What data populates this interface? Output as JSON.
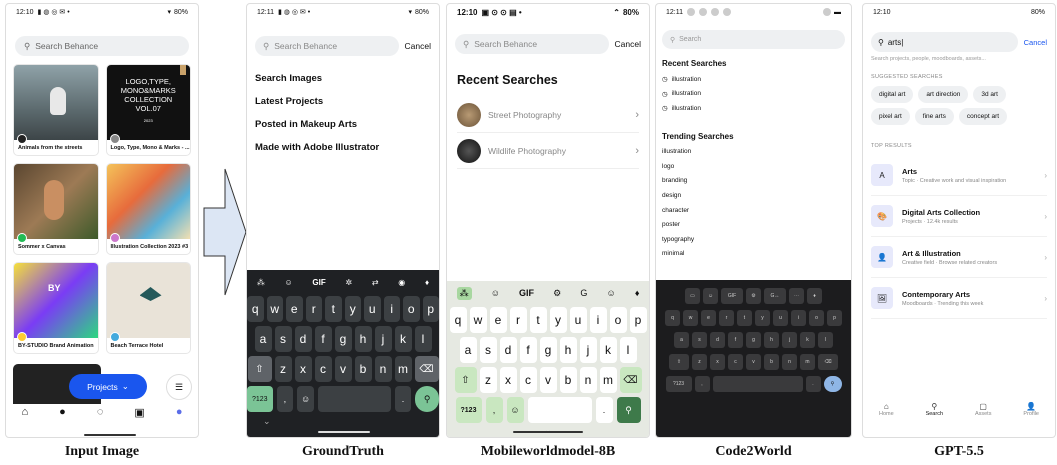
{
  "captions": [
    "Input Image",
    "GroundTruth",
    "Mobileworldmodel-8B",
    "Code2World",
    "GPT-5.5"
  ],
  "input": {
    "status": {
      "time": "12:10",
      "battery": "80%"
    },
    "search_placeholder": "Search Behance",
    "cards": [
      "Animals from the streets",
      "Logo, Type, Mono & Marks - ...",
      "Sommer x Canvas",
      "Illustration Collection 2023 #3",
      "BY-STUDIO Brand Animation",
      "Beach Terrace Hotel"
    ],
    "logo_card_text": [
      "LOGO,TYPE,",
      "MONO&MARKS",
      "COLLECTION",
      "VOL.07",
      "2023"
    ],
    "projects_button": "Projects"
  },
  "groundtruth": {
    "status": {
      "time": "12:11",
      "battery": "80%"
    },
    "search_placeholder": "Search Behance",
    "cancel": "Cancel",
    "suggestions": [
      "Search Images",
      "Latest Projects",
      "Posted in Makeup Arts",
      "Made with Adobe Illustrator"
    ],
    "kb_rows": [
      [
        "q",
        "w",
        "e",
        "r",
        "t",
        "y",
        "u",
        "i",
        "o",
        "p"
      ],
      [
        "a",
        "s",
        "d",
        "f",
        "g",
        "h",
        "j",
        "k",
        "l"
      ],
      [
        "z",
        "x",
        "c",
        "v",
        "b",
        "n",
        "m"
      ]
    ],
    "kb_gif": "GIF",
    "kb_num": "?123"
  },
  "mobile": {
    "status": {
      "time": "12:10",
      "battery": "80%"
    },
    "search_placeholder": "Search Behance",
    "cancel": "Cancel",
    "recent_title": "Recent Searches",
    "recent": [
      "Street Photography",
      "Wildlife Photography"
    ],
    "kb_gif": "GIF",
    "kb_num": "?123"
  },
  "code2world": {
    "status": {
      "time": "12:11"
    },
    "search_placeholder": "Search",
    "recent_title": "Recent Searches",
    "recent": [
      "illustration",
      "illustration",
      "illustration"
    ],
    "trending_title": "Trending Searches",
    "trending": [
      "illustration",
      "logo",
      "branding",
      "design",
      "character",
      "poster",
      "typography",
      "minimal"
    ],
    "kb_gif": "GIF",
    "kb_num": "?123"
  },
  "gpt": {
    "status": {
      "time": "12:10",
      "battery": "80%"
    },
    "query": "arts|",
    "cancel": "Cancel",
    "subtitle": "Search projects, people, moodboards, assets...",
    "suggested_title": "SUGGESTED SEARCHES",
    "chips": [
      "digital art",
      "art direction",
      "3d art",
      "pixel art",
      "fine arts",
      "concept art"
    ],
    "top_title": "TOP RESULTS",
    "results": [
      {
        "t": "Arts",
        "d": "Topic · Creative work and visual inspiration",
        "icon": "A"
      },
      {
        "t": "Digital Arts Collection",
        "d": "Projects · 12.4k results",
        "icon": "🎨"
      },
      {
        "t": "Art & Illustration",
        "d": "Creative field · Browse related creators",
        "icon": "👤"
      },
      {
        "t": "Contemporary Arts",
        "d": "Moodboards · Trending this week",
        "icon": "🖼"
      }
    ],
    "nav": [
      "Home",
      "Search",
      "Assets",
      "Profile"
    ]
  }
}
